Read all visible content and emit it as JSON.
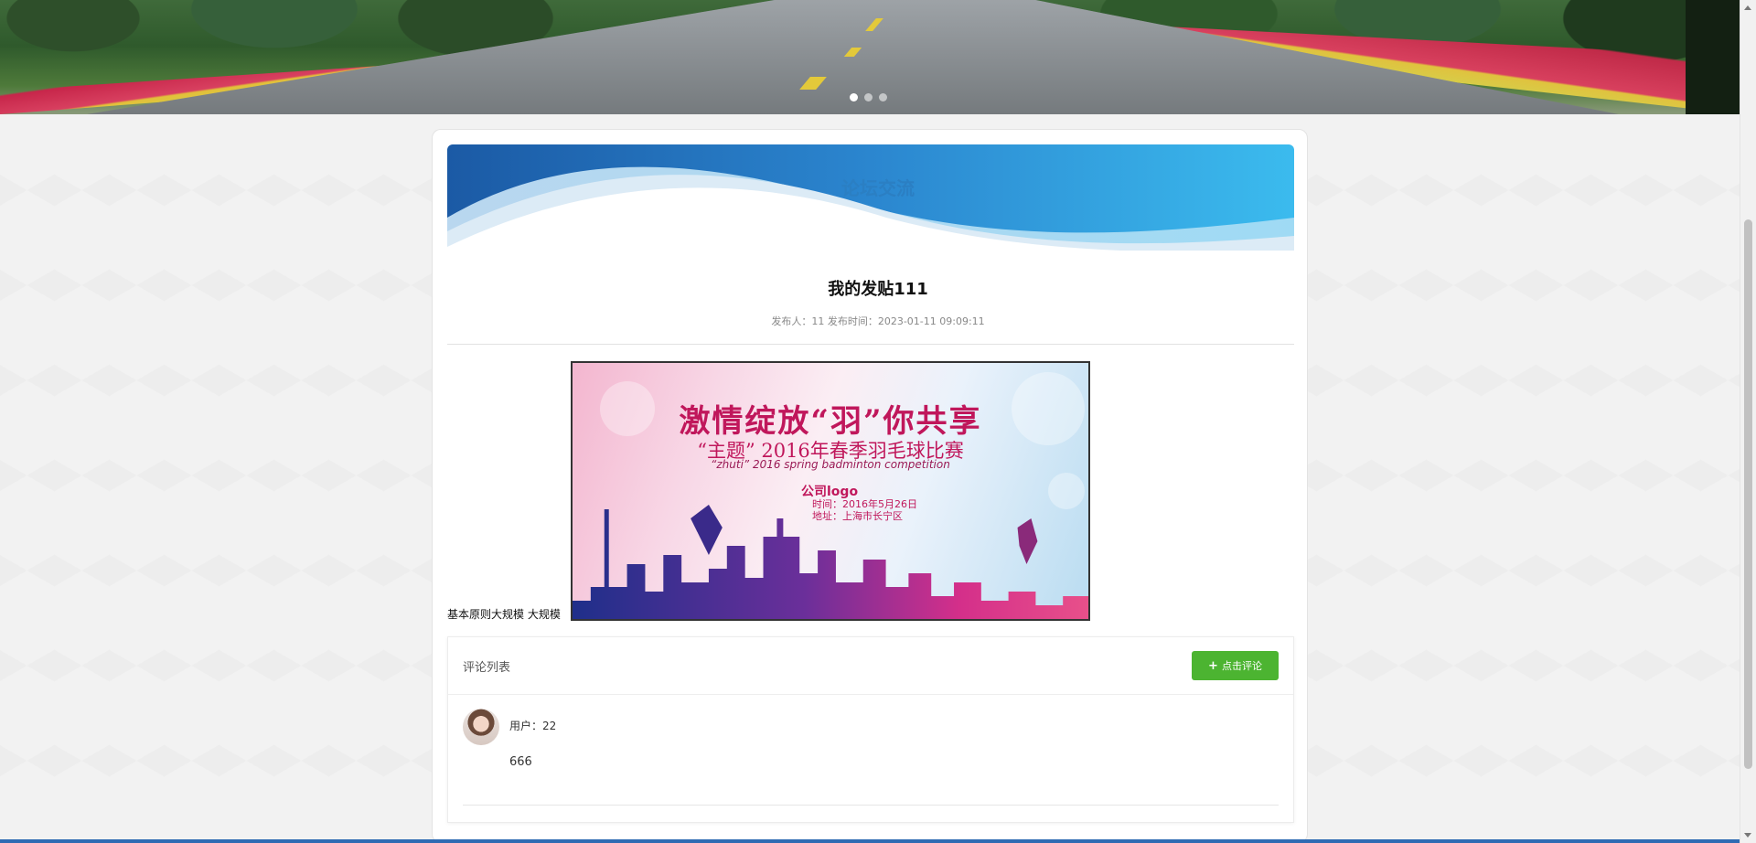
{
  "banner": {
    "slides": 3,
    "active_slide": 1
  },
  "section": {
    "title": "论坛交流"
  },
  "post": {
    "title": "我的发贴111",
    "meta": "发布人：11  发布时间：2023-01-11 09:09:11",
    "text": "基本原则大规模 大规模",
    "poster": {
      "headline": "激情绽放“羽”你共享",
      "subtitle": "“主题” 2016年春季羽毛球比赛",
      "subtitle_en": "“zhuti”  2016 spring  badminton competition",
      "company": "公司logo",
      "time": "时间：2016年5月26日",
      "place": "地址：上海市长宁区"
    }
  },
  "comments": {
    "title": "评论列表",
    "button_label": "点击评论",
    "items": [
      {
        "user": "用户：22",
        "content": "666"
      }
    ]
  },
  "colors": {
    "accent_blue": "#2b7fc3",
    "button_green": "#4cb431",
    "footer_blue": "#2e6bb3"
  }
}
